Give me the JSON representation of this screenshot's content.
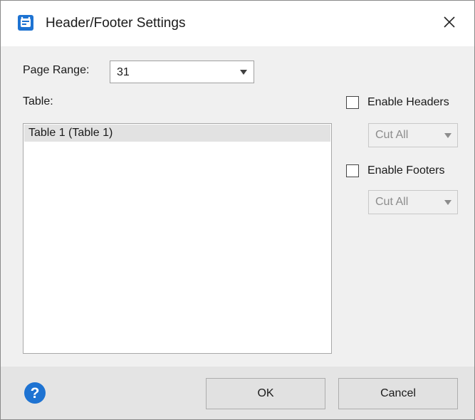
{
  "window": {
    "title": "Header/Footer Settings",
    "icon": "app-logo-icon",
    "close_icon": "close-icon"
  },
  "page_range": {
    "label": "Page Range:",
    "value": "31"
  },
  "table": {
    "label": "Table:",
    "items": [
      {
        "label": "Table 1 (Table 1)",
        "selected": true
      }
    ]
  },
  "headers": {
    "checkbox_label": "Enable Headers",
    "checked": false,
    "mode": "Cut All",
    "enabled": false
  },
  "footers": {
    "checkbox_label": "Enable Footers",
    "checked": false,
    "mode": "Cut All",
    "enabled": false
  },
  "footer_bar": {
    "help_icon": "help-icon",
    "ok_label": "OK",
    "cancel_label": "Cancel"
  },
  "colors": {
    "accent": "#1e73d2",
    "dialog_bg": "#f0f0f0",
    "footer_bg": "#e4e4e4"
  }
}
